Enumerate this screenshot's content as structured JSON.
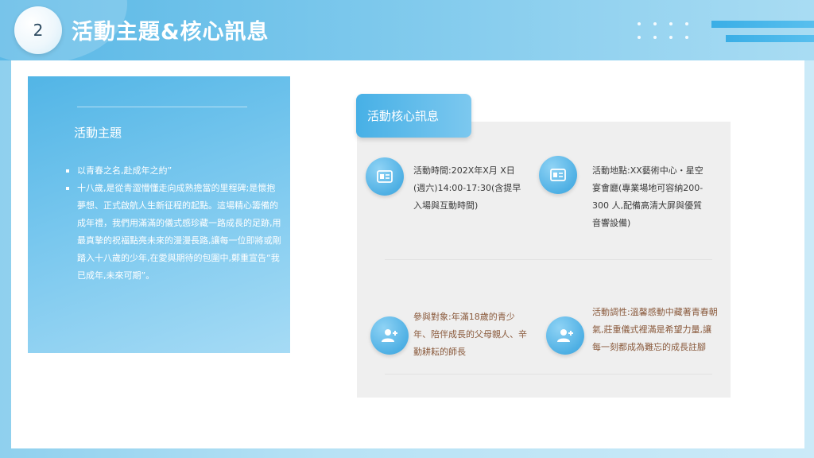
{
  "header": {
    "page_number": "2",
    "title": "活動主題&核心訊息"
  },
  "theme": {
    "heading": "活動主題",
    "items": [
      "以青春之名,赴成年之約”",
      "十八歲,是從青澀懵懂走向成熟擔當的里程碑;是懷抱夢想、正式啟航人生新征程的起點。這場精心籌備的成年禮，我們用滿滿的儀式感珍藏一路成長的足跡,用最真摯的祝福點亮未來的漫漫長路,讓每一位即將或剛踏入十八歲的少年,在愛與期待的包圍中,鄭重宣告“我已成年,未來可期”。"
    ]
  },
  "core": {
    "tab_label": "活動核心訊息",
    "time": "活動時間:202X年X月 X日(週六)14:00-17:30(含提早入場與互動時間)",
    "venue": "活動地點:XX藝術中心・星空宴會廳(專業場地可容納200-300 人,配備高清大屏與優質音響設備)",
    "audience": "參與對象:年滿18歲的青少年、陪伴成長的父母親人、辛勤耕耘的師長",
    "tone": "活動調性:溫馨感動中藏著青春朝氣,莊重儀式裡滿是希望力量,讓每一刻都成為難忘的成長註腳"
  },
  "icons": {
    "time": "id-card-icon",
    "venue": "id-card-icon",
    "audience": "add-user-icon",
    "tone": "add-user-icon"
  },
  "colors": {
    "accent_blue": "#4fb0e4",
    "brown_text": "#8a5a3c"
  }
}
